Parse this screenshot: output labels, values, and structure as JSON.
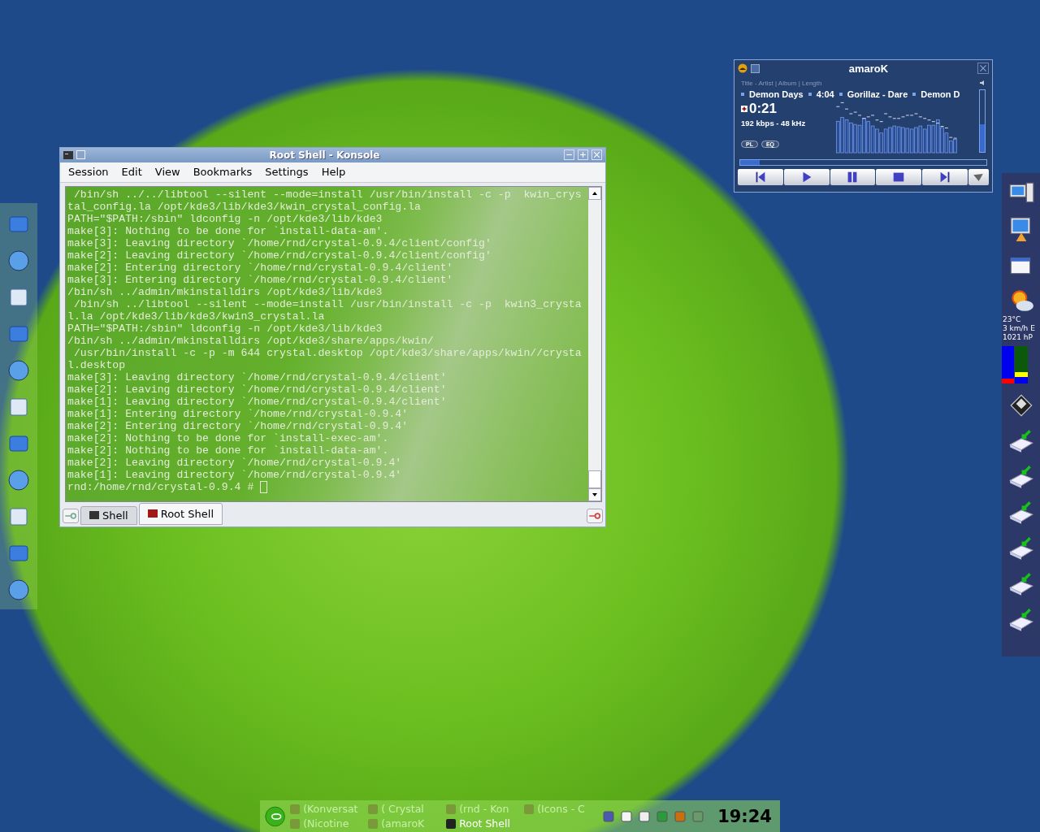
{
  "konsole": {
    "title": "Root Shell - Konsole",
    "menu": [
      "Session",
      "Edit",
      "View",
      "Bookmarks",
      "Settings",
      "Help"
    ],
    "lines": [
      " /bin/sh ../../libtool --silent --mode=install /usr/bin/install -c -p  kwin_crys",
      "tal_config.la /opt/kde3/lib/kde3/kwin_crystal_config.la",
      "PATH=\"$PATH:/sbin\" ldconfig -n /opt/kde3/lib/kde3",
      "make[3]: Nothing to be done for `install-data-am'.",
      "make[3]: Leaving directory `/home/rnd/crystal-0.9.4/client/config'",
      "make[2]: Leaving directory `/home/rnd/crystal-0.9.4/client/config'",
      "make[2]: Entering directory `/home/rnd/crystal-0.9.4/client'",
      "make[3]: Entering directory `/home/rnd/crystal-0.9.4/client'",
      "/bin/sh ../admin/mkinstalldirs /opt/kde3/lib/kde3",
      " /bin/sh ../libtool --silent --mode=install /usr/bin/install -c -p  kwin3_crysta",
      "l.la /opt/kde3/lib/kde3/kwin3_crystal.la",
      "PATH=\"$PATH:/sbin\" ldconfig -n /opt/kde3/lib/kde3",
      "/bin/sh ../admin/mkinstalldirs /opt/kde3/share/apps/kwin/",
      " /usr/bin/install -c -p -m 644 crystal.desktop /opt/kde3/share/apps/kwin//crysta",
      "l.desktop",
      "make[3]: Leaving directory `/home/rnd/crystal-0.9.4/client'",
      "make[2]: Leaving directory `/home/rnd/crystal-0.9.4/client'",
      "make[1]: Leaving directory `/home/rnd/crystal-0.9.4/client'",
      "make[1]: Entering directory `/home/rnd/crystal-0.9.4'",
      "make[2]: Entering directory `/home/rnd/crystal-0.9.4'",
      "make[2]: Nothing to be done for `install-exec-am'.",
      "make[2]: Nothing to be done for `install-data-am'.",
      "make[2]: Leaving directory `/home/rnd/crystal-0.9.4'",
      "make[1]: Leaving directory `/home/rnd/crystal-0.9.4'"
    ],
    "prompt": "rnd:/home/rnd/crystal-0.9.4 # ",
    "tabs": [
      {
        "label": "Shell",
        "selected": false
      },
      {
        "label": "Root Shell",
        "selected": true
      }
    ]
  },
  "amarok": {
    "title": "amaroK",
    "header": "Title - Artist | Album | Length",
    "ticker": [
      "Demon Days",
      "4:04",
      "Gorillaz - Dare",
      "Demon D"
    ],
    "time": "0:21",
    "bitrate": "192 kbps - 48 kHz",
    "toggles": [
      "PL",
      "EQ"
    ],
    "seek": {
      "level": 0.08
    },
    "volume": {
      "level": 0.45
    }
  },
  "weather": [
    "23°C",
    "3 km/h E",
    "1021 hP"
  ],
  "taskbar": {
    "tasks": [
      {
        "label": "(Konversat",
        "selected": false
      },
      {
        "label": "( Crystal",
        "selected": false
      },
      {
        "label": "(rnd - Kon",
        "selected": false
      },
      {
        "label": "(Icons - C",
        "selected": false
      },
      {
        "label": "(Nicotine",
        "selected": false
      },
      {
        "label": "(amaroK",
        "selected": false
      },
      {
        "label": "Root Shell",
        "selected": true
      }
    ],
    "clock": "19:24"
  }
}
